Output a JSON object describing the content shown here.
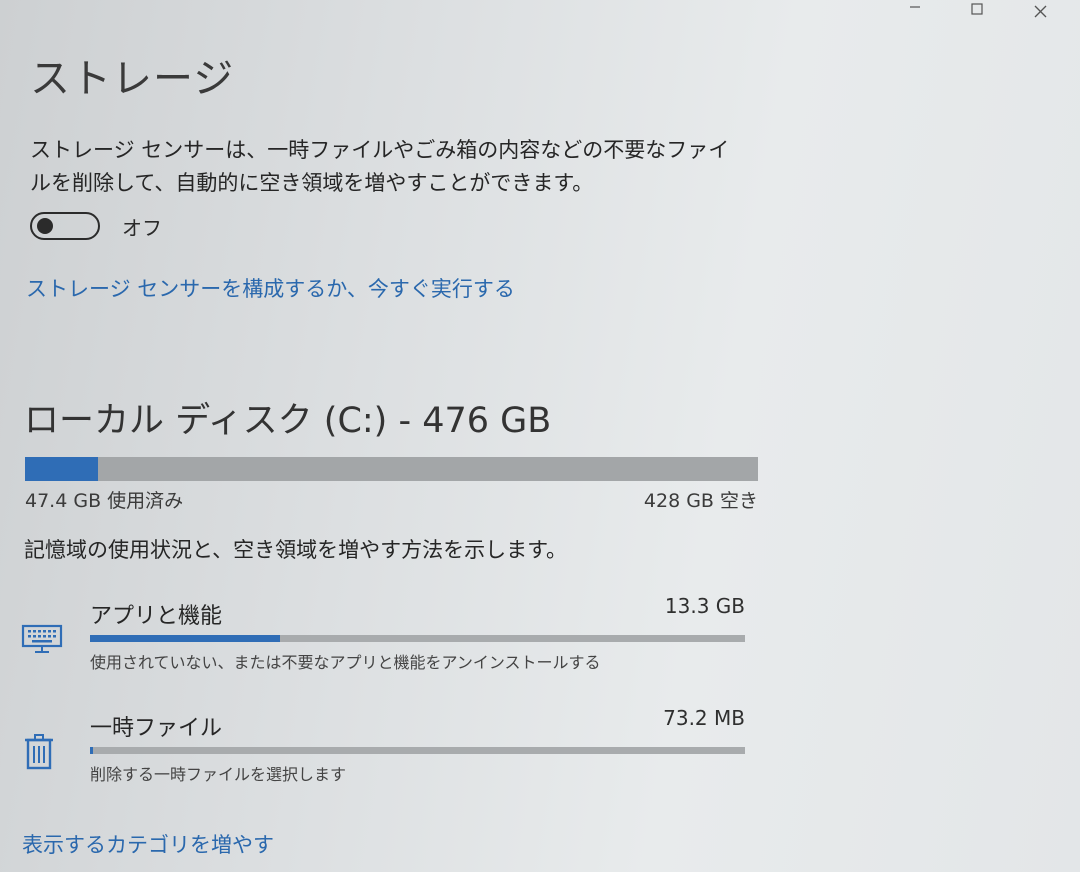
{
  "window": {
    "minimize_icon": "minimize-icon",
    "maximize_icon": "maximize-icon",
    "close_icon": "close-icon"
  },
  "page": {
    "title": "ストレージ"
  },
  "storage_sense": {
    "description": "ストレージ センサーは、一時ファイルやごみ箱の内容などの不要なファイルを削除して、自動的に空き領域を増やすことができます。",
    "toggle_state": "オフ",
    "toggle_on": false,
    "configure_link": "ストレージ センサーを構成するか、今すぐ実行する"
  },
  "drive": {
    "title": "ローカル ディスク (C:) - 476 GB",
    "used_label": "47.4 GB 使用済み",
    "free_label": "428 GB 空き",
    "used_fraction": 0.1,
    "usage_note": "記憶域の使用状況と、空き領域を増やす方法を示します。"
  },
  "categories": [
    {
      "name": "アプリと機能",
      "size": "13.3 GB",
      "description": "使用されていない、または不要なアプリと機能をアンインストールする",
      "icon": "keyboard-icon",
      "fill_fraction": 0.29
    },
    {
      "name": "一時ファイル",
      "size": "73.2 MB",
      "description": "削除する一時ファイルを選択します",
      "icon": "trash-icon",
      "fill_fraction": 0.004
    }
  ],
  "more_link": "表示するカテゴリを増やす",
  "colors": {
    "accent": "#2f6db6",
    "link": "#2a68ad",
    "bar_track": "#a3a6a8"
  }
}
